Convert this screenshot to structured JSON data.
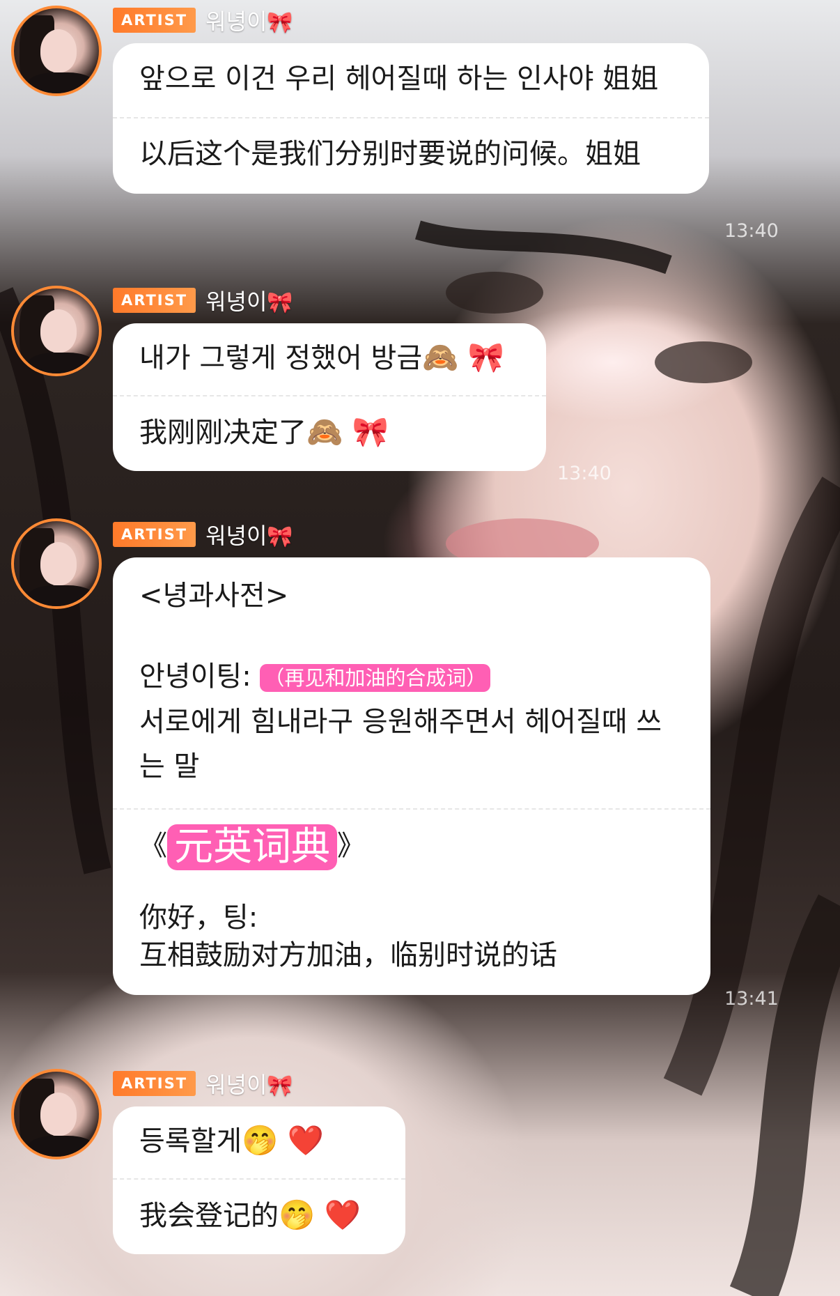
{
  "sender": {
    "badge": "ARTIST",
    "name": "워녕이",
    "bow_icon": "🎀"
  },
  "messages": [
    {
      "korean": "앞으로 이건 우리 헤어질때 하는 인사야 姐姐",
      "chinese": "以后这个是我们分别时要说的问候。姐姐",
      "time": "13:40"
    },
    {
      "korean": "내가 그렇게 정했어 방금",
      "korean_emojis": "🙈 🎀",
      "chinese": "我刚刚决定了",
      "chinese_emojis": "🙈 🎀",
      "time": "13:40"
    },
    {
      "title": "<녕과사전>",
      "term": "안녕이팅:",
      "term_note": "（再见和加油的合成词）",
      "definition": "서로에게 힘내라구 응원해주면서 헤어질때 쓰는 말",
      "cn_title_open": "《",
      "cn_title": "元英词典",
      "cn_title_close": "》",
      "cn_term": "你好，팅:",
      "cn_definition": "互相鼓励对方加油，临别时说的话",
      "time": "13:41"
    },
    {
      "korean": "등록할게",
      "korean_emojis": "🤭 ❤️",
      "chinese": "我会登记的",
      "chinese_emojis": "🤭 ❤️"
    }
  ]
}
